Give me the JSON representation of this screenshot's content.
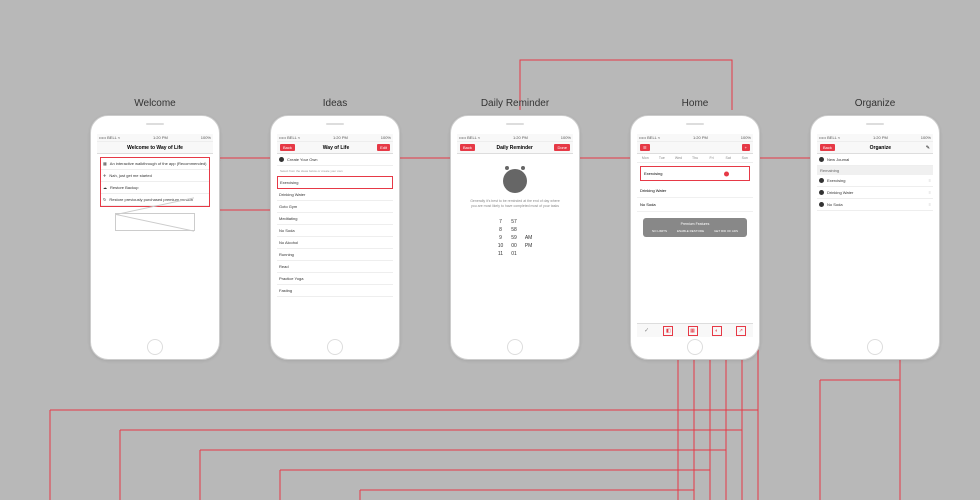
{
  "screens": {
    "welcome": {
      "label": "Welcome",
      "title": "Welcome to Way of Life",
      "items": [
        "An interactive walkthrough of the app (Recommended)",
        "Nah, just get me started",
        "Restore Backup",
        "Restore previously purchased premium version"
      ]
    },
    "ideas": {
      "label": "Ideas",
      "title": "Way of Life",
      "back": "Back",
      "edit": "Edit",
      "create": "Create Your Own",
      "hint": "Select from the ideas below or create your own",
      "items": [
        "Exercising",
        "Drinking Water",
        "Goto Gym",
        "Meditating",
        "No Soda",
        "No Alcohol",
        "Running",
        "Read",
        "Practice Yoga",
        "Fasting"
      ]
    },
    "reminder": {
      "label": "Daily Reminder",
      "title": "Daily Reminder",
      "back": "Back",
      "done": "Done",
      "desc": "Generally it's best to be reminded at the end of day where you are most likely to have completed most of your tasks",
      "picker": {
        "h": [
          "7",
          "8",
          "9",
          "10",
          "11"
        ],
        "m": [
          "57",
          "58",
          "59",
          "00",
          "01"
        ],
        "ap": [
          "AM",
          "PM"
        ]
      }
    },
    "home": {
      "label": "Home",
      "title": "",
      "days": [
        "Mon",
        "Tue",
        "Wed",
        "Thu",
        "Fri",
        "Sat",
        "Sun"
      ],
      "rows": [
        "Exercising",
        "Drinking Water",
        "No Soda"
      ],
      "premium": {
        "title": "Premium Features",
        "items": [
          "NO LIMITS",
          "ENABLE RESTORE",
          "GET RID OF ADS"
        ]
      }
    },
    "organize": {
      "label": "Organize",
      "title": "Organize",
      "back": "Back",
      "items": [
        "New Journal"
      ],
      "section": "Remaining",
      "remaining": [
        "Exercising",
        "Drinking Water",
        "No Soda"
      ]
    }
  },
  "statusbar": {
    "left": "••••• BELL ≈",
    "center": "1:20 PM",
    "right": "100%"
  }
}
